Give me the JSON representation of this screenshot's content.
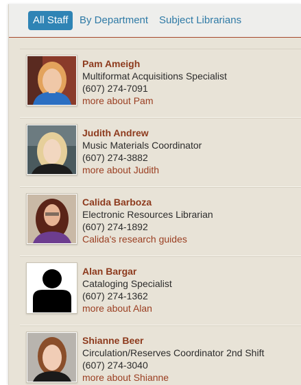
{
  "tabs": [
    {
      "label": "All Staff",
      "active": true
    },
    {
      "label": "By Department",
      "active": false
    },
    {
      "label": "Subject Librarians",
      "active": false
    }
  ],
  "staff": [
    {
      "name": "Pam Ameigh",
      "title": "Multiformat Acquisitions Specialist",
      "phone": "(607) 274-7091",
      "link": "more about Pam"
    },
    {
      "name": "Judith Andrew",
      "title": "Music Materials Coordinator",
      "phone": "(607) 274-3882",
      "link": "more about Judith"
    },
    {
      "name": "Calida Barboza",
      "title": "Electronic Resources Librarian",
      "phone": "(607) 274-1892",
      "link": "Calida's research guides"
    },
    {
      "name": "Alan Bargar",
      "title": "Cataloging Specialist",
      "phone": "(607) 274-1362",
      "link": "more about Alan"
    },
    {
      "name": "Shianne Beer",
      "title": "Circulation/Reserves Coordinator 2nd Shift",
      "phone": "(607) 274-3040",
      "link": "more about Shianne"
    }
  ],
  "colors": {
    "accent": "#2f84b5",
    "link": "#2f7aa6",
    "name": "#8d3a1d",
    "background": "#e8e3d7"
  }
}
